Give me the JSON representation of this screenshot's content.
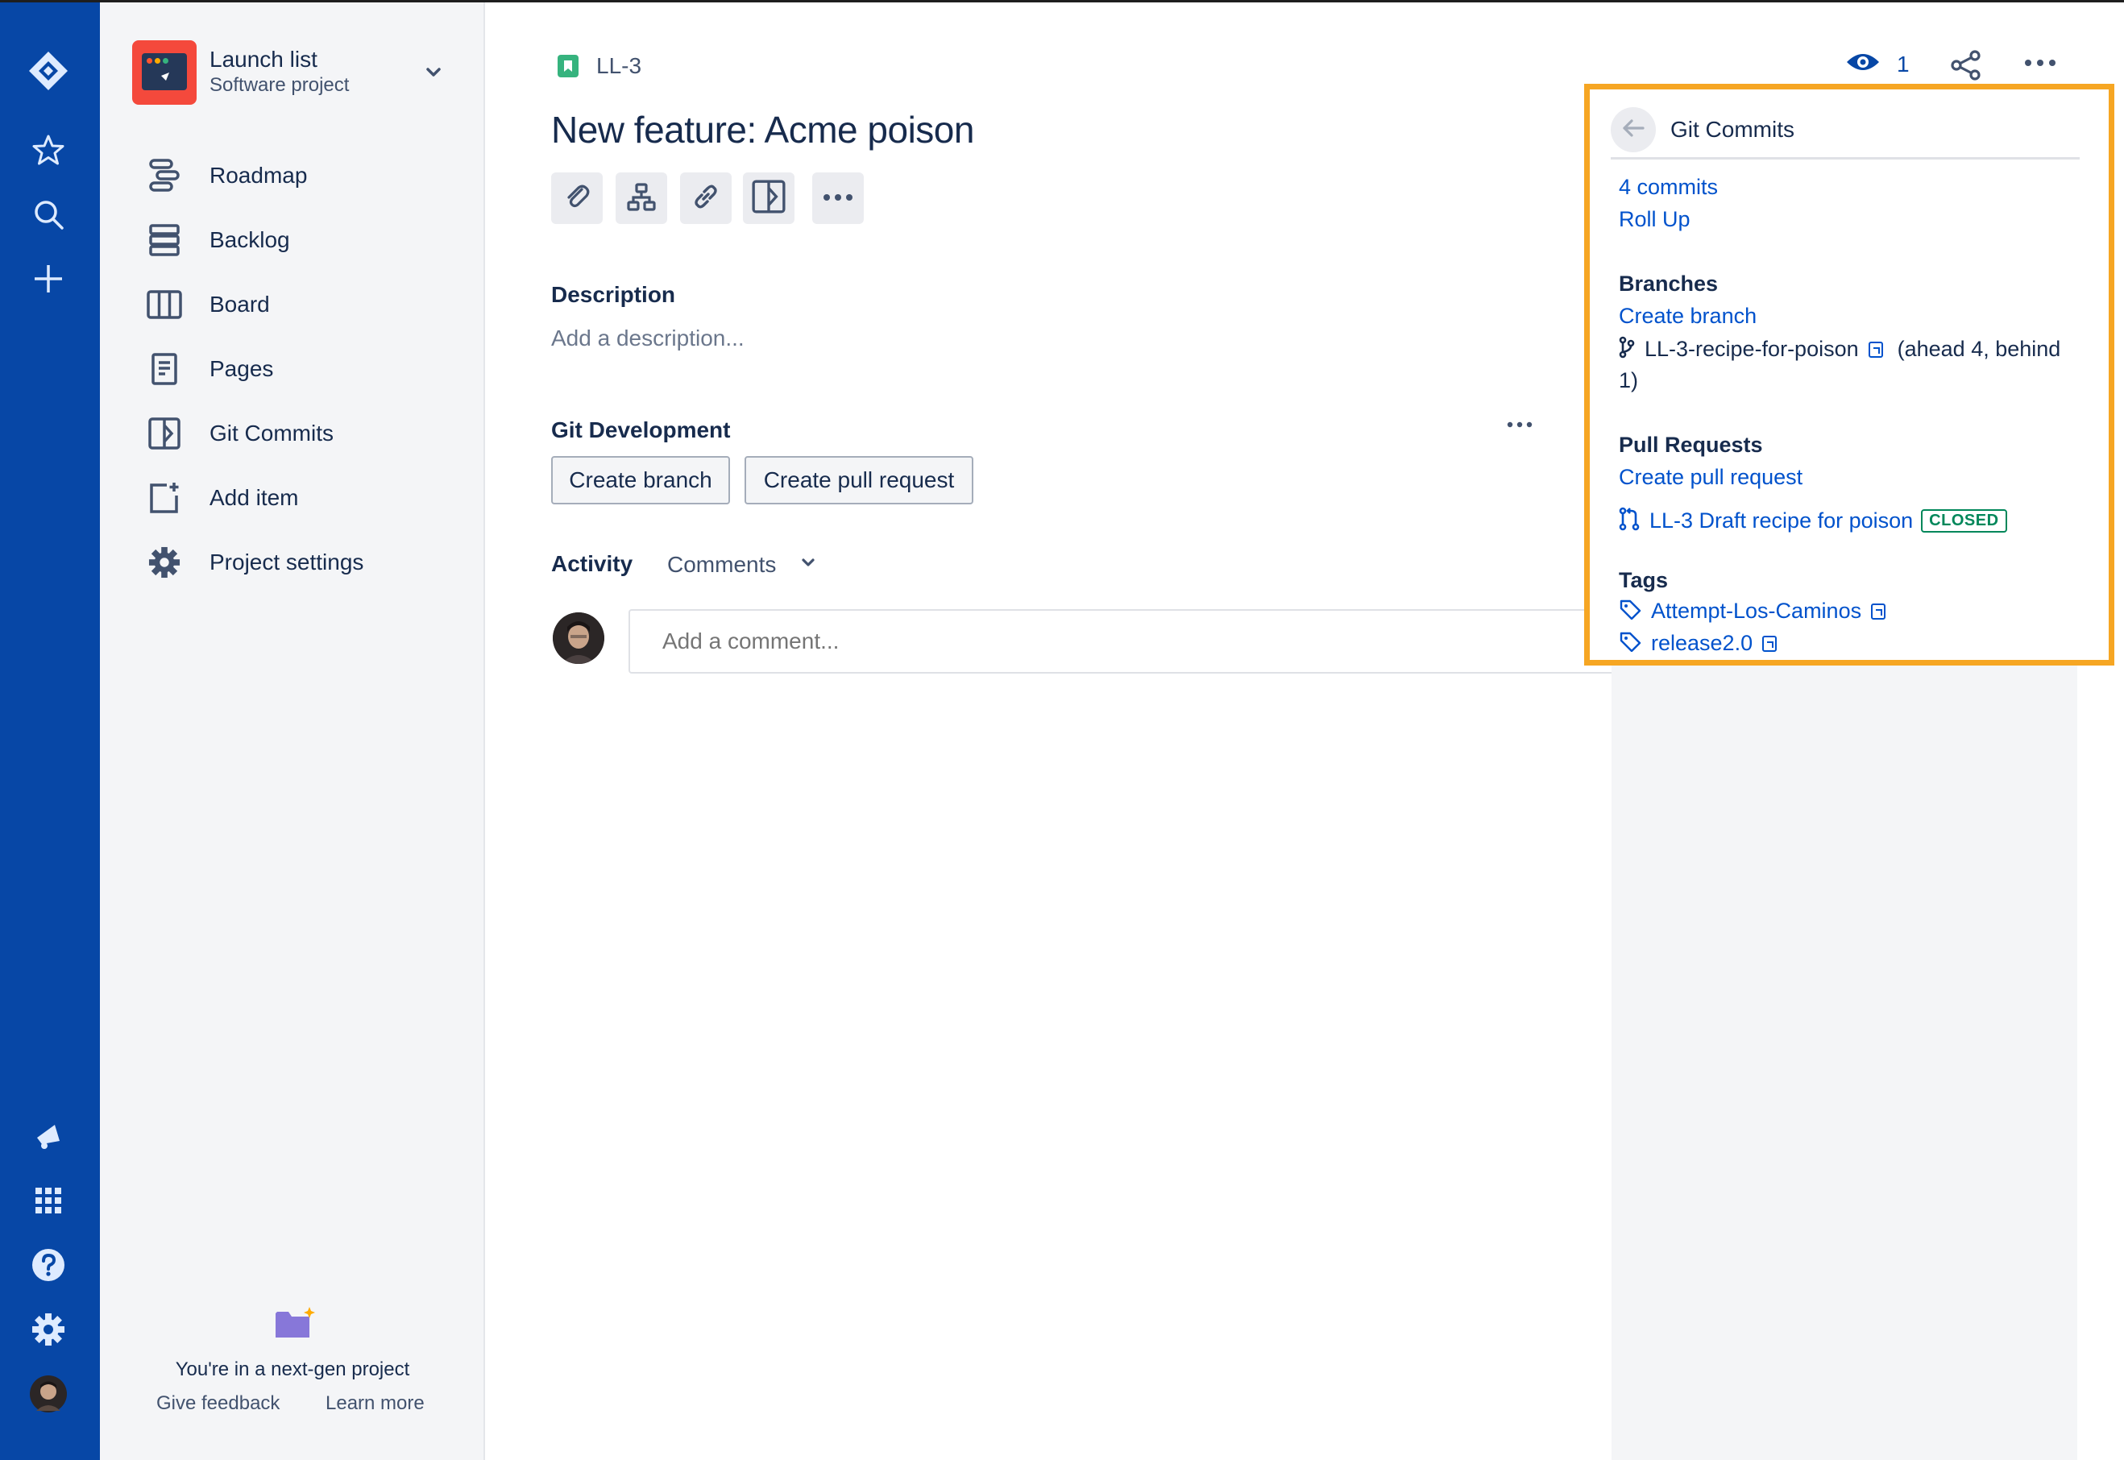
{
  "sidebar": {
    "project_name": "Launch list",
    "project_type": "Software project",
    "items": [
      {
        "label": "Roadmap"
      },
      {
        "label": "Backlog"
      },
      {
        "label": "Board"
      },
      {
        "label": "Pages"
      },
      {
        "label": "Git Commits"
      },
      {
        "label": "Add item"
      },
      {
        "label": "Project settings"
      }
    ],
    "footer": {
      "message": "You're in a next-gen project",
      "feedback": "Give feedback",
      "learn": "Learn more"
    }
  },
  "issue": {
    "key": "LL-3",
    "title": "New feature: Acme poison",
    "description_label": "Description",
    "description_placeholder": "Add a description...",
    "git_dev_label": "Git Development",
    "create_branch": "Create branch",
    "create_pr": "Create pull request",
    "activity_label": "Activity",
    "activity_filter": "Comments",
    "comment_placeholder": "Add a comment..."
  },
  "header": {
    "watch_count": "1"
  },
  "git_panel": {
    "title": "Git Commits",
    "commits_link": "4 commits",
    "rollup_link": "Roll Up",
    "branches_heading": "Branches",
    "create_branch_link": "Create branch",
    "branch_name": "LL-3-recipe-for-poison",
    "branch_status_1": "(ahead 4, behind",
    "branch_status_2": "1)",
    "pr_heading": "Pull Requests",
    "create_pr_link": "Create pull request",
    "pr_title": "LL-3 Draft recipe for poison",
    "pr_status": "CLOSED",
    "tags_heading": "Tags",
    "tags": [
      "Attempt-Los-Caminos",
      "release2.0"
    ]
  },
  "colors": {
    "global_nav": "#0747a6",
    "link": "#0052cc",
    "highlight_border": "#f6a623",
    "closed_badge": "#00875a"
  }
}
